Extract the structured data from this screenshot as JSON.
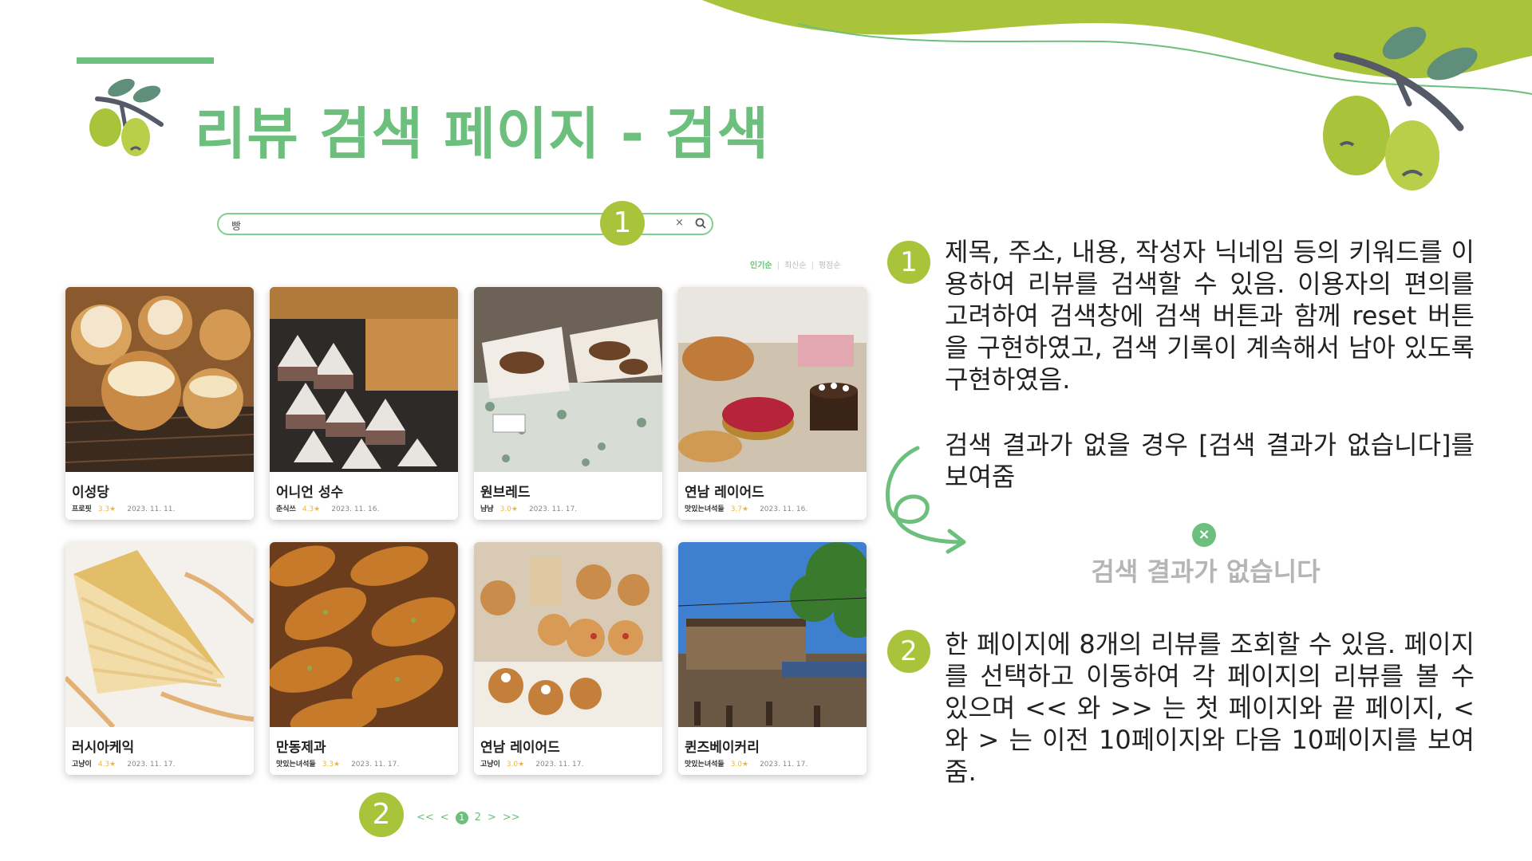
{
  "title": "리뷰 검색 페이지 - 검색",
  "search": {
    "value": "빵",
    "clear_icon": "×",
    "badge": "1"
  },
  "sort_tabs": [
    "인기순",
    "최신순",
    "평점순"
  ],
  "cards": [
    {
      "name": "이성당",
      "author": "프로핏",
      "rating": "3.3★",
      "date": "2023. 11. 11.",
      "photo": "cream-puffs"
    },
    {
      "name": "어니언 성수",
      "author": "춘식쓰",
      "rating": "4.3★",
      "date": "2023. 11. 16.",
      "photo": "powdered-breads"
    },
    {
      "name": "원브레드",
      "author": "냠냠",
      "rating": "3.0★",
      "date": "2023. 11. 17.",
      "photo": "bread-baskets"
    },
    {
      "name": "연남 레이어드",
      "author": "맛있는녀석들",
      "rating": "3.7★",
      "date": "2023. 11. 16.",
      "photo": "cakes-display"
    },
    {
      "name": "러시아케익",
      "author": "고냥이",
      "rating": "4.3★",
      "date": "2023. 11. 17.",
      "photo": "layer-cake-slice"
    },
    {
      "name": "만동제과",
      "author": "맛있는녀석들",
      "rating": "3.3★",
      "date": "2023. 11. 17.",
      "photo": "garlic-breads"
    },
    {
      "name": "연남 레이어드",
      "author": "고냥이",
      "rating": "3.0★",
      "date": "2023. 11. 17.",
      "photo": "scones-display"
    },
    {
      "name": "퀸즈베이커리",
      "author": "맛있는녀석들",
      "rating": "3.0★",
      "date": "2023. 11. 17.",
      "photo": "bakery-storefront"
    }
  ],
  "pagination": {
    "first": "<<",
    "prev": "<",
    "current": "1",
    "page2": "2",
    "next": ">",
    "last": ">>",
    "badge": "2"
  },
  "descriptions": {
    "badge1": "1",
    "text1": "제목, 주소, 내용, 작성자 닉네임 등의 키워드를 이용하여 리뷰를 검색할 수 있음. 이용자의 편의를 고려하여 검색창에 검색 버튼과 함께 reset 버튼을 구현하였고, 검색 기록이 계속해서 남아 있도록 구현하였음.",
    "noresult_text": "검색 결과가 없을 경우 [검색 결과가 없습니다]를 보여줌",
    "noresult_example": "검색 결과가 없습니다",
    "noresult_icon": "×",
    "badge2": "2",
    "text2": "한 페이지에 8개의 리뷰를 조회할 수 있음. 페이지를 선택하고 이동하여 각 페이지의 리뷰를 볼 수 있으며 << 와 >> 는 첫 페이지와 끝 페이지, < 와 > 는 이전 10페이지와 다음 10페이지를 보여줌."
  },
  "colors": {
    "accent_green": "#6cbf7c",
    "olive_badge": "#a9c33a",
    "rating_star": "#f2b53a"
  }
}
